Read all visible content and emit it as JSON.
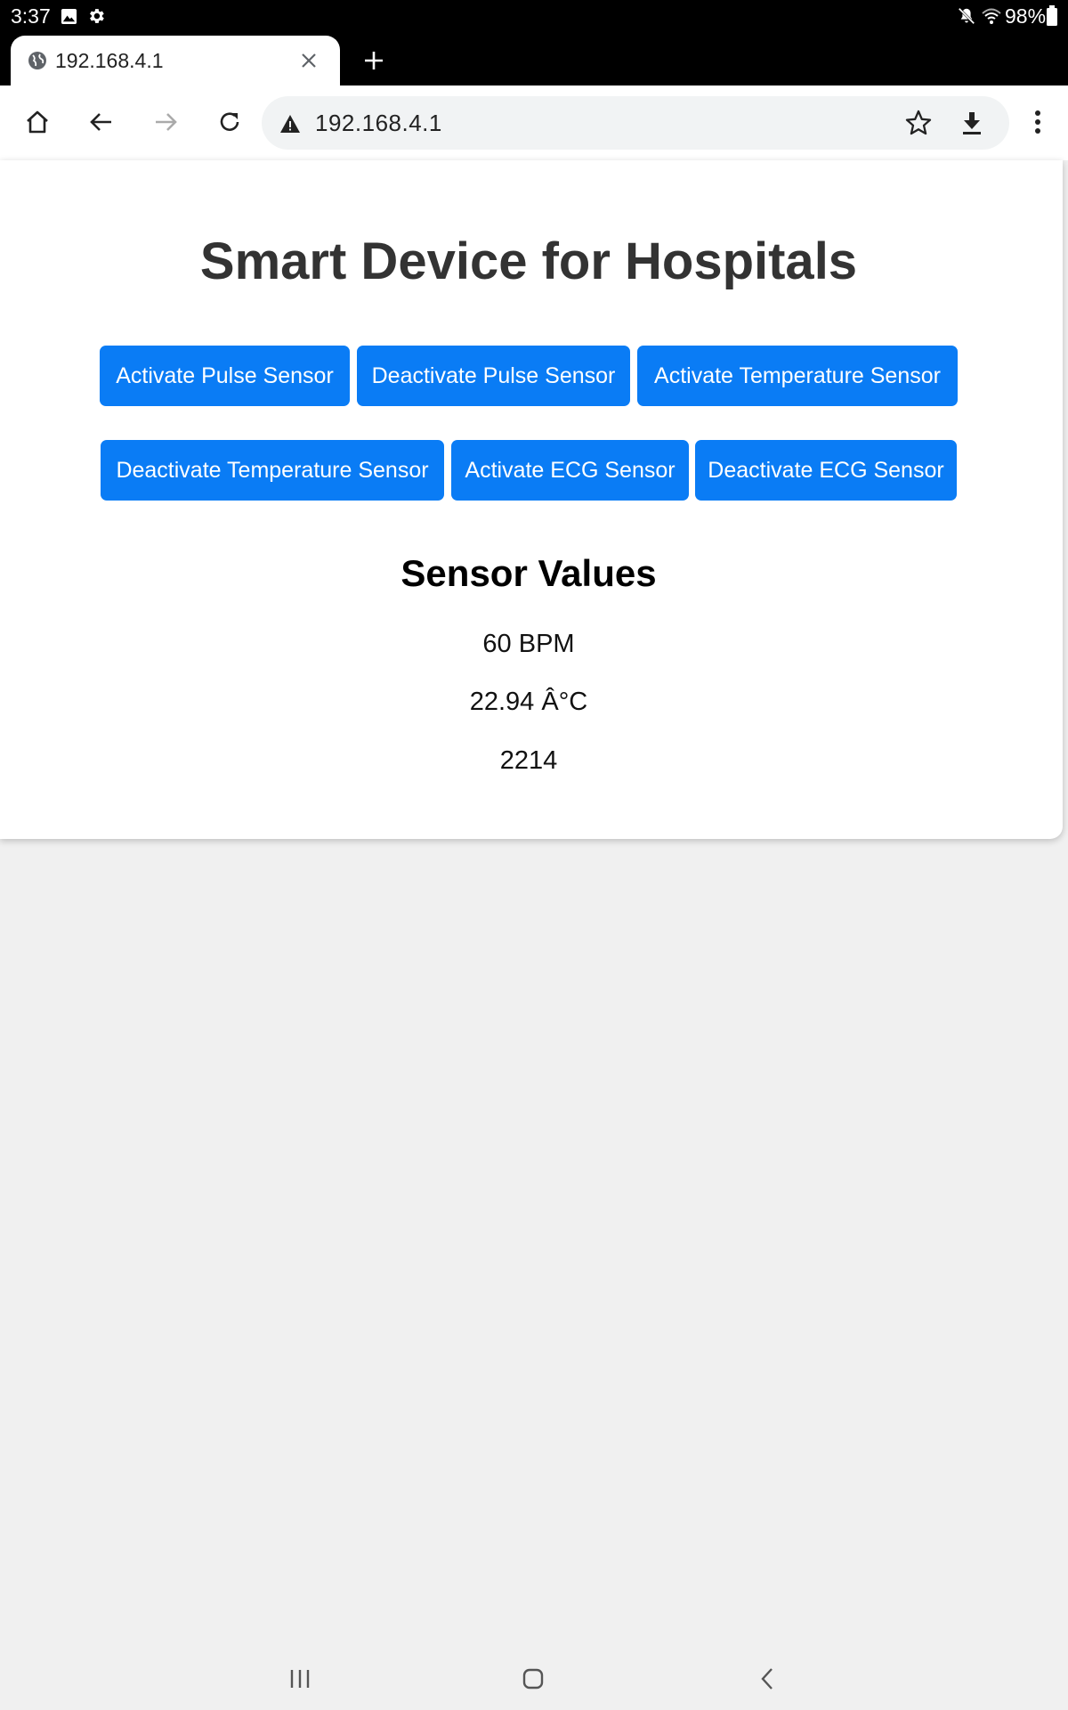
{
  "status_bar": {
    "time": "3:37",
    "battery": "98%",
    "icons": [
      "image-icon",
      "gear-icon",
      "mute-icon",
      "wifi-icon",
      "battery-icon"
    ]
  },
  "browser": {
    "tab_title": "192.168.4.1",
    "url": "192.168.4.1",
    "icons": [
      "globe-icon",
      "close-icon",
      "plus-icon",
      "home-icon",
      "back-icon",
      "forward-icon",
      "reload-icon",
      "warning-icon",
      "star-icon",
      "download-icon",
      "more-icon"
    ]
  },
  "page": {
    "title": "Smart Device for Hospitals",
    "buttons": [
      "Activate Pulse Sensor",
      "Deactivate Pulse Sensor",
      "Activate Temperature Sensor",
      "Deactivate Temperature Sensor",
      "Activate ECG Sensor",
      "Deactivate ECG Sensor"
    ],
    "button_color": "#0a7cf5",
    "section_title": "Sensor Values",
    "values": {
      "pulse": "60 BPM",
      "temperature": "22.94 Â°C",
      "ecg": "2214"
    }
  },
  "nav_bar": {
    "icons": [
      "recent-apps-icon",
      "home-nav-icon",
      "back-nav-icon"
    ]
  }
}
